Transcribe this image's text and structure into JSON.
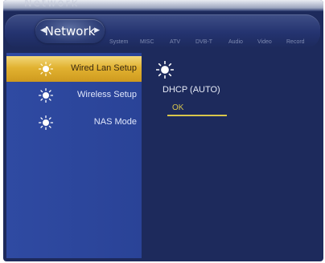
{
  "header": {
    "reflection_text": "Network",
    "active_tab": "Network",
    "tabs": [
      "System",
      "MISC",
      "ATV",
      "DVB-T",
      "Audio",
      "Video",
      "Record"
    ]
  },
  "sidebar": {
    "items": [
      {
        "label": "Wired Lan Setup",
        "icon": "sun-icon",
        "selected": true
      },
      {
        "label": "Wireless Setup",
        "icon": "sun-icon",
        "selected": false
      },
      {
        "label": "NAS Mode",
        "icon": "sun-icon",
        "selected": false
      }
    ]
  },
  "content": {
    "icon": "sun-icon",
    "mode_label": "DHCP (AUTO)",
    "ok_label": "OK"
  },
  "colors": {
    "background": "#1d2a5c",
    "panel": "#2f4aa2",
    "selected": "#e1b231",
    "ok_accent": "#d9c64b"
  }
}
